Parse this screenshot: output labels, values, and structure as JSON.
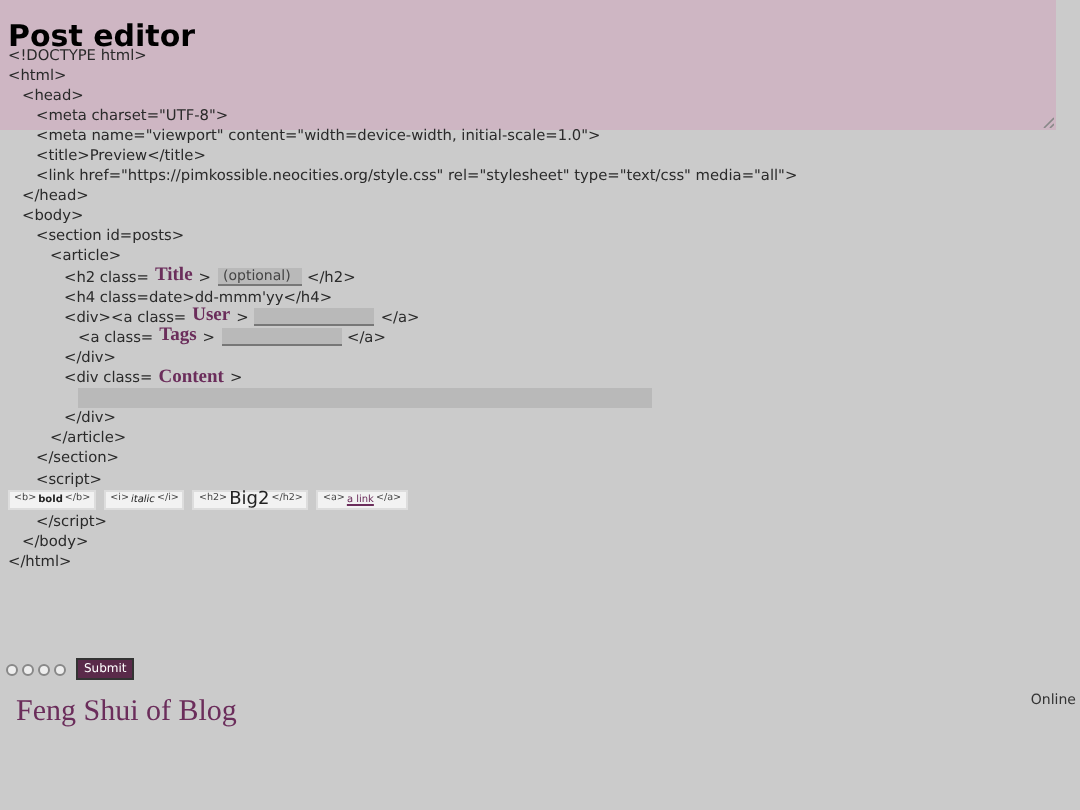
{
  "editor": {
    "title": "Post editor"
  },
  "source": [
    {
      "parts": [
        {
          "kind": "code",
          "text": "<!DOCTYPE html>"
        }
      ]
    },
    {
      "parts": [
        {
          "kind": "code",
          "text": "<html>"
        }
      ],
      "children": [
        {
          "parts": [
            {
              "kind": "code",
              "text": "<head>"
            }
          ],
          "children": [
            {
              "parts": [
                {
                  "kind": "code",
                  "text": "<meta charset=\"UTF-8\">"
                }
              ]
            },
            {
              "parts": [
                {
                  "kind": "code",
                  "text": "<meta name=\"viewport\" content=\"width=device-width, initial-scale=1.0\">"
                }
              ]
            },
            {
              "parts": [
                {
                  "kind": "code",
                  "text": "<title>Preview</title>"
                }
              ]
            },
            {
              "parts": [
                {
                  "kind": "code",
                  "text": "<link href=\"https://pimkossible.neocities.org/style.css\" rel=\"stylesheet\" type=\"text/css\" media=\"all\">"
                }
              ]
            }
          ]
        },
        {
          "parts": [
            {
              "kind": "code",
              "text": "</head>"
            }
          ]
        },
        {
          "parts": [
            {
              "kind": "code",
              "text": "<body>"
            }
          ],
          "children": [
            {
              "parts": [
                {
                  "kind": "code",
                  "text": "<section id=posts>"
                }
              ],
              "children": [
                {
                  "parts": [
                    {
                      "kind": "code",
                      "text": "<article>"
                    }
                  ],
                  "children": [
                    {
                      "parts": [
                        {
                          "kind": "code",
                          "text": "<h2 class="
                        },
                        {
                          "kind": "keyword",
                          "text": "Title"
                        },
                        {
                          "kind": "code",
                          "text": ">"
                        },
                        {
                          "kind": "field",
                          "placeholder": "(optional)"
                        },
                        {
                          "kind": "code",
                          "text": "</h2>"
                        }
                      ]
                    },
                    {
                      "parts": [
                        {
                          "kind": "code",
                          "text": "<h4 class=date>dd-mmm'yy</h4>"
                        }
                      ]
                    },
                    {
                      "parts": [
                        {
                          "kind": "code",
                          "text": "<div><a class="
                        },
                        {
                          "kind": "keyword",
                          "text": "User"
                        },
                        {
                          "kind": "code",
                          "text": ">"
                        },
                        {
                          "kind": "field"
                        },
                        {
                          "kind": "code",
                          "text": "</a>"
                        }
                      ],
                      "children": [
                        {
                          "parts": [
                            {
                              "kind": "code",
                              "text": "<a class="
                            },
                            {
                              "kind": "keyword",
                              "text": "Tags"
                            },
                            {
                              "kind": "code",
                              "text": ">"
                            },
                            {
                              "kind": "field"
                            },
                            {
                              "kind": "code",
                              "text": "</a>"
                            }
                          ]
                        }
                      ]
                    },
                    {
                      "parts": [
                        {
                          "kind": "code",
                          "text": "</div>"
                        }
                      ]
                    },
                    {
                      "parts": [
                        {
                          "kind": "code",
                          "text": "<div class="
                        },
                        {
                          "kind": "keyword",
                          "text": "Content"
                        },
                        {
                          "kind": "code",
                          "text": ">"
                        }
                      ],
                      "children": [
                        {
                          "parts": [
                            {
                              "kind": "area"
                            }
                          ]
                        }
                      ]
                    },
                    {
                      "parts": [
                        {
                          "kind": "code",
                          "text": "</div>"
                        }
                      ]
                    }
                  ]
                },
                {
                  "parts": [
                    {
                      "kind": "code",
                      "text": "</article>"
                    }
                  ]
                }
              ]
            },
            {
              "parts": [
                {
                  "kind": "code",
                  "text": "</section>"
                }
              ]
            },
            {
              "parts": [
                {
                  "kind": "code",
                  "text": "<script>"
                }
              ]
            },
            {
              "kind": "snippets",
              "buttons": [
                {
                  "kind": "bold",
                  "open": "<b>",
                  "inner": "bold",
                  "close": "</b>"
                },
                {
                  "kind": "italic",
                  "open": "<i>",
                  "inner": "italic",
                  "close": "</i>"
                },
                {
                  "kind": "heading",
                  "open": "<h2>",
                  "inner": "Big2",
                  "close": "</h2>"
                },
                {
                  "kind": "link",
                  "open": "<a>",
                  "inner": "a link",
                  "close": "</a>"
                }
              ]
            },
            {
              "parts": [
                {
                  "kind": "code",
                  "text": "</script>"
                }
              ]
            }
          ]
        },
        {
          "parts": [
            {
              "kind": "code",
              "text": "</body>"
            }
          ]
        }
      ]
    },
    {
      "parts": [
        {
          "kind": "code",
          "text": "</html>"
        }
      ]
    }
  ],
  "form": {
    "radios": [
      {
        "selected": false
      },
      {
        "selected": false
      },
      {
        "selected": false
      },
      {
        "selected": false
      }
    ],
    "submit": "Submit"
  },
  "footer": {
    "blog_title": "Feng Shui of Blog",
    "status": "Online"
  }
}
